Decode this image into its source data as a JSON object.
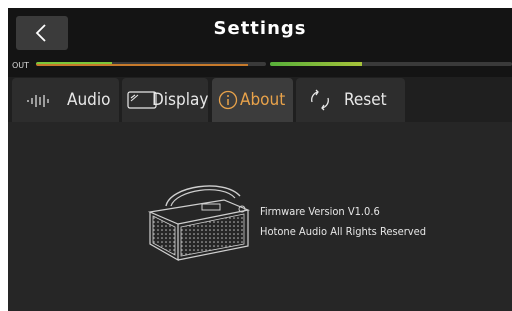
{
  "header": {
    "title": "Settings",
    "back_icon": "chevron-left-icon"
  },
  "meter": {
    "label": "OUT",
    "out_left_level": 0.46,
    "out_right_level": 0.38,
    "colors": {
      "green": "#7cc63a",
      "orange": "#c77a2b"
    }
  },
  "tabs": [
    {
      "label": "Audio",
      "icon": "waveform-icon",
      "active": false
    },
    {
      "label": "Display",
      "icon": "display-icon",
      "active": false
    },
    {
      "label": "About",
      "icon": "info-icon",
      "active": true
    },
    {
      "label": "Reset",
      "icon": "reset-icon",
      "active": false
    }
  ],
  "about": {
    "device_image": "speaker-illustration",
    "firmware_version": "Firmware Version V1.0.6",
    "copyright": "Hotone Audio All Rights Reserved"
  },
  "colors": {
    "accent": "#e8a24a",
    "background": "#1f1f1f",
    "header": "#141414"
  }
}
